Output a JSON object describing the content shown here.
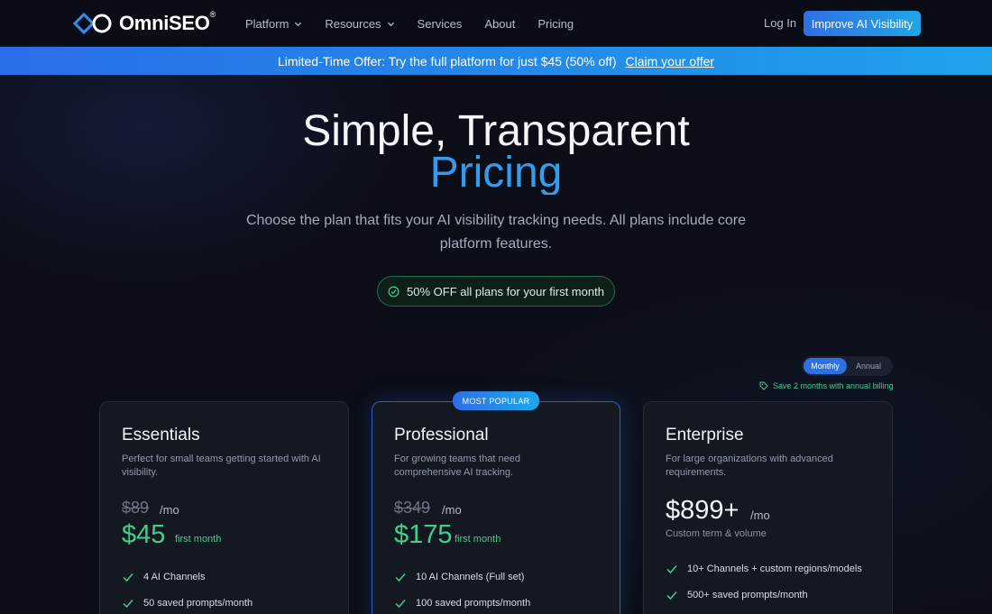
{
  "colors": {
    "accent": "#2f6fe6",
    "accent2": "#1fa6e8",
    "green": "#3fcf8e",
    "background": "#0b0e17"
  },
  "nav": {
    "brand": "OmniSEO",
    "brand_mark": "®",
    "links": [
      {
        "label": "Platform",
        "has_dropdown": true
      },
      {
        "label": "Resources",
        "has_dropdown": true
      },
      {
        "label": "Services",
        "has_dropdown": false
      },
      {
        "label": "About",
        "has_dropdown": false
      },
      {
        "label": "Pricing",
        "has_dropdown": false
      }
    ],
    "login": "Log In",
    "cta": "Improve AI Visibility"
  },
  "banner": {
    "text": "Limited-Time Offer: Try the full platform for just $45 (50% off)",
    "link": "Claim your offer"
  },
  "hero": {
    "title_line1": "Simple, Transparent",
    "title_line2": "Pricing",
    "subtitle": "Choose the plan that fits your AI visibility tracking needs. All plans include core platform features.",
    "discount": "50% OFF all plans for your first month"
  },
  "billing": {
    "monthly": "Monthly",
    "annual": "Annual",
    "selected": "Monthly",
    "save_note": "Save 2 months with annual billing"
  },
  "plans": [
    {
      "name": "Essentials",
      "description": "Perfect for small teams getting started with AI visibility.",
      "old_price": "$89",
      "period": "/mo",
      "price": "$45",
      "price_note": "first month",
      "features": [
        "4 AI Channels",
        "50 saved prompts/month"
      ]
    },
    {
      "name": "Professional",
      "badge": "MOST POPULAR",
      "description": "For growing teams that need comprehensive AI tracking.",
      "old_price": "$349",
      "period": "/mo",
      "price": "$175",
      "price_note": "first month",
      "features": [
        "10 AI Channels (Full set)",
        "100 saved prompts/month"
      ]
    },
    {
      "name": "Enterprise",
      "description": "For large organizations with advanced requirements.",
      "price": "$899+",
      "period": "/mo",
      "price_note": "Custom term & volume",
      "features": [
        "10+ Channels + custom regions/models",
        "500+ saved prompts/month"
      ]
    }
  ]
}
